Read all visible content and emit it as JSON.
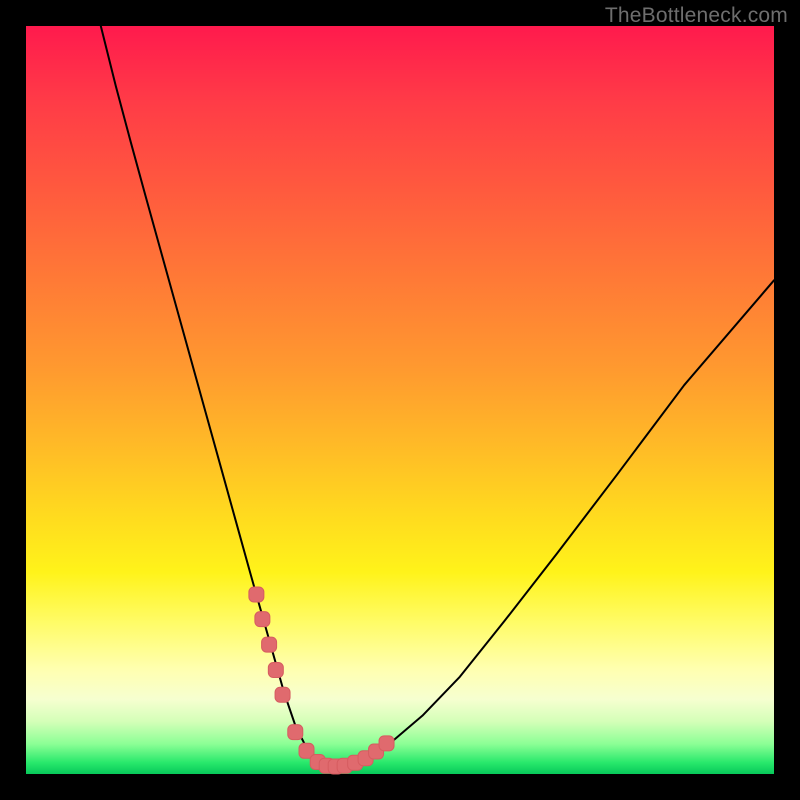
{
  "watermark": "TheBottleneck.com",
  "colors": {
    "curve_stroke": "#000000",
    "marker_fill": "#e06a6e",
    "marker_stroke": "#d65c60"
  },
  "chart_data": {
    "type": "line",
    "title": "",
    "xlabel": "",
    "ylabel": "",
    "xlim": [
      0,
      100
    ],
    "ylim": [
      0,
      100
    ],
    "grid": false,
    "legend": false,
    "series": [
      {
        "name": "bottleneck-curve",
        "x": [
          10,
          12,
          14,
          16,
          18,
          20,
          22,
          24,
          26,
          28,
          30,
          31.5,
          33,
          34.5,
          36,
          37.5,
          39,
          40,
          41.5,
          43.5,
          46,
          49,
          53,
          58,
          64,
          71,
          79,
          88,
          100
        ],
        "values": [
          100,
          92,
          84.5,
          77.2,
          70,
          62.8,
          55.6,
          48.4,
          41.2,
          34,
          26.8,
          21.5,
          16.2,
          10.9,
          6.5,
          3.5,
          1.6,
          1.0,
          1.0,
          1.4,
          2.4,
          4.4,
          7.8,
          13.0,
          20.5,
          29.5,
          40.0,
          52.0,
          66.0
        ]
      }
    ],
    "markers": {
      "name": "highlight-band",
      "x": [
        30.8,
        31.6,
        32.5,
        33.4,
        34.3,
        36.0,
        37.5,
        39.0,
        40.2,
        41.4,
        42.6,
        44.0,
        45.4,
        46.8,
        48.2
      ],
      "values": [
        24.0,
        20.7,
        17.3,
        13.9,
        10.6,
        5.6,
        3.1,
        1.6,
        1.1,
        1.0,
        1.1,
        1.5,
        2.1,
        3.0,
        4.1
      ]
    }
  }
}
